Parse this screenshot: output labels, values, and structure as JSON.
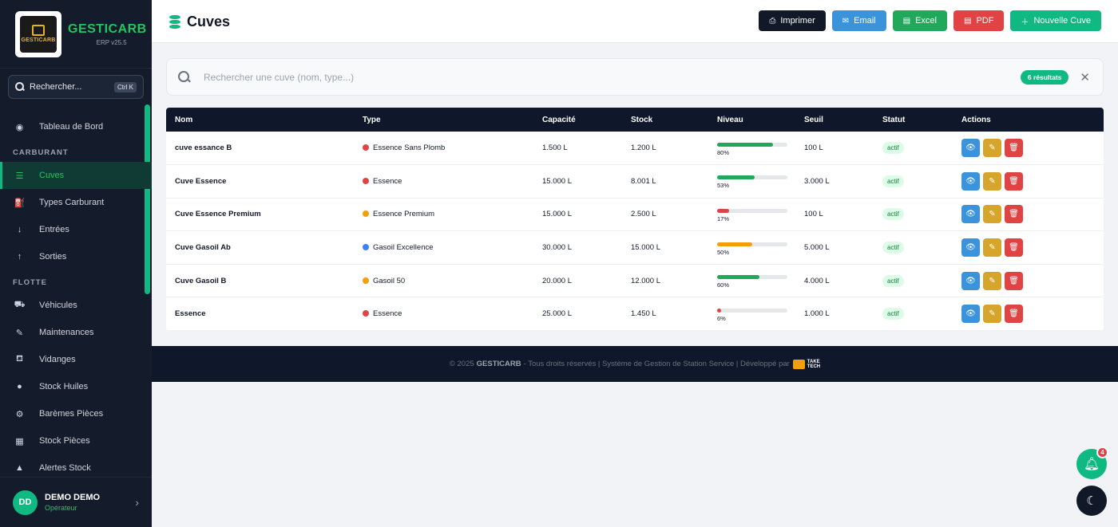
{
  "brand": {
    "name": "GESTICARB",
    "version": "ERP v25.5",
    "logo_text": "GESTICARB"
  },
  "sidebar": {
    "search_label": "Rechercher...",
    "search_shortcut": "Ctrl K",
    "items": [
      {
        "label": "Tableau de Bord",
        "icon": "dashboard-icon",
        "glyph": "◉"
      },
      {
        "section": "CARBURANT"
      },
      {
        "label": "Cuves",
        "icon": "database-icon",
        "glyph": "☰",
        "active": true
      },
      {
        "label": "Types Carburant",
        "icon": "gas-pump-icon",
        "glyph": "⛽"
      },
      {
        "label": "Entrées",
        "icon": "arrow-down-icon",
        "glyph": "↓"
      },
      {
        "label": "Sorties",
        "icon": "arrow-up-icon",
        "glyph": "↑"
      },
      {
        "section": "FLOTTE"
      },
      {
        "label": "Véhicules",
        "icon": "car-icon",
        "glyph": "⛟"
      },
      {
        "label": "Maintenances",
        "icon": "wrench-icon",
        "glyph": "✎"
      },
      {
        "label": "Vidanges",
        "icon": "oil-can-icon",
        "glyph": "⛾"
      },
      {
        "label": "Stock Huiles",
        "icon": "drop-icon",
        "glyph": "●"
      },
      {
        "label": "Barèmes Pièces",
        "icon": "cogs-icon",
        "glyph": "⚙"
      },
      {
        "label": "Stock Pièces",
        "icon": "boxes-icon",
        "glyph": "▦"
      },
      {
        "label": "Alertes Stock",
        "icon": "warning-icon",
        "glyph": "▲"
      }
    ]
  },
  "user": {
    "initials": "DD",
    "name": "DEMO DEMO",
    "role": "Opérateur"
  },
  "header": {
    "title": "Cuves",
    "buttons": {
      "print": "Imprimer",
      "email": "Email",
      "excel": "Excel",
      "pdf": "PDF",
      "new": "Nouvelle Cuve"
    }
  },
  "search": {
    "placeholder": "Rechercher une cuve (nom, type...)",
    "results_badge": "6 résultats"
  },
  "table": {
    "columns": [
      "Nom",
      "Type",
      "Capacité",
      "Stock",
      "Niveau",
      "Seuil",
      "Statut",
      "Actions"
    ],
    "rows": [
      {
        "nom": "cuve essance B",
        "type": "Essence Sans Plomb",
        "type_color": "#e04343",
        "capacite": "1.500 L",
        "stock": "1.200 L",
        "niveau": 80,
        "niveau_label": "80%",
        "niveau_color": "#22a85a",
        "seuil": "100 L",
        "statut": "actif"
      },
      {
        "nom": "Cuve Essence",
        "type": "Essence",
        "type_color": "#e04343",
        "capacite": "15.000 L",
        "stock": "8.001 L",
        "niveau": 53,
        "niveau_label": "53%",
        "niveau_color": "#22a85a",
        "seuil": "3.000 L",
        "statut": "actif"
      },
      {
        "nom": "Cuve Essence Premium",
        "type": "Essence Premium",
        "type_color": "#f59e0b",
        "capacite": "15.000 L",
        "stock": "2.500 L",
        "niveau": 17,
        "niveau_label": "17%",
        "niveau_color": "#e04343",
        "seuil": "100 L",
        "statut": "actif"
      },
      {
        "nom": "Cuve Gasoil Ab",
        "type": "Gasoil Excellence",
        "type_color": "#3b82f6",
        "capacite": "30.000 L",
        "stock": "15.000 L",
        "niveau": 50,
        "niveau_label": "50%",
        "niveau_color": "#f59e0b",
        "seuil": "5.000 L",
        "statut": "actif"
      },
      {
        "nom": "Cuve Gasoil B",
        "type": "Gasoil 50",
        "type_color": "#f59e0b",
        "capacite": "20.000 L",
        "stock": "12.000 L",
        "niveau": 60,
        "niveau_label": "60%",
        "niveau_color": "#22a85a",
        "seuil": "4.000 L",
        "statut": "actif"
      },
      {
        "nom": "Essence",
        "type": "Essence",
        "type_color": "#e04343",
        "capacite": "25.000 L",
        "stock": "1.450 L",
        "niveau": 6,
        "niveau_label": "6%",
        "niveau_color": "#e04343",
        "seuil": "1.000 L",
        "statut": "actif"
      }
    ]
  },
  "footer": {
    "prefix": "© 2025",
    "brand": "GESTICARB",
    "text": "- Tous droits réservés | Système de Gestion de Station Service | Développé par",
    "dev_logo_line1": "TAKE",
    "dev_logo_line2": "TECH"
  },
  "notifications": {
    "count": "4"
  },
  "colors": {
    "accent": "#10b981",
    "sidebar_bg": "#141b2b",
    "header_table": "#0f172a"
  }
}
